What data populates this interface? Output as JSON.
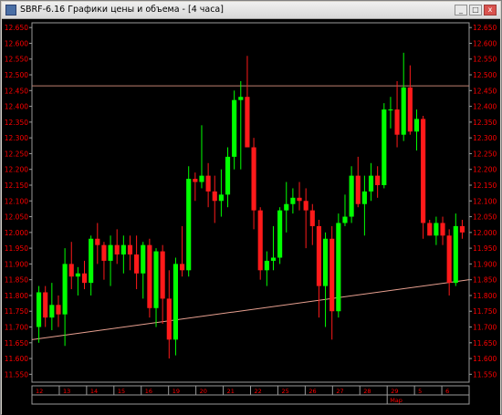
{
  "window": {
    "title": "SBRF-6.16 Графики цены и объема - [4 часа]",
    "buttons": {
      "minimize": "_",
      "maximize": "□",
      "close": "x"
    }
  },
  "chart_data": {
    "type": "candlestick",
    "title": "",
    "y_ticks": [
      "12.650",
      "12.600",
      "12.550",
      "12.500",
      "12.450",
      "12.400",
      "12.350",
      "12.300",
      "12.250",
      "12.200",
      "12.150",
      "12.100",
      "12.050",
      "12.000",
      "11.950",
      "11.900",
      "11.850",
      "11.800",
      "11.750",
      "11.700",
      "11.650",
      "11.600",
      "11.550"
    ],
    "ylim": [
      11.525,
      12.665
    ],
    "x_labels": [
      "12",
      "13",
      "14",
      "15",
      "16",
      "19",
      "20",
      "21",
      "22",
      "25",
      "26",
      "27",
      "28",
      "29",
      "5",
      "6"
    ],
    "x_sublabel": "Мар",
    "colors": {
      "up": "#00ff00",
      "down": "#ff1a1a",
      "axis_text": "#ff0000",
      "background": "#000000",
      "hline": "#c08070",
      "trendline": "#e8a090"
    },
    "horizontal_line": 12.465,
    "trendline": [
      [
        0,
        11.66
      ],
      [
        62,
        11.85
      ]
    ],
    "candles": [
      {
        "o": 11.7,
        "h": 11.83,
        "l": 11.65,
        "c": 11.81
      },
      {
        "o": 11.81,
        "h": 11.83,
        "l": 11.7,
        "c": 11.73
      },
      {
        "o": 11.73,
        "h": 11.84,
        "l": 11.69,
        "c": 11.77
      },
      {
        "o": 11.77,
        "h": 11.8,
        "l": 11.7,
        "c": 11.74
      },
      {
        "o": 11.74,
        "h": 11.95,
        "l": 11.64,
        "c": 11.9
      },
      {
        "o": 11.9,
        "h": 11.97,
        "l": 11.82,
        "c": 11.86
      },
      {
        "o": 11.86,
        "h": 11.89,
        "l": 11.8,
        "c": 11.87
      },
      {
        "o": 11.87,
        "h": 11.91,
        "l": 11.82,
        "c": 11.84
      },
      {
        "o": 11.84,
        "h": 11.99,
        "l": 11.8,
        "c": 11.98
      },
      {
        "o": 11.98,
        "h": 12.03,
        "l": 11.9,
        "c": 11.96
      },
      {
        "o": 11.96,
        "h": 11.97,
        "l": 11.85,
        "c": 11.91
      },
      {
        "o": 11.91,
        "h": 11.99,
        "l": 11.83,
        "c": 11.96
      },
      {
        "o": 11.96,
        "h": 12.01,
        "l": 11.9,
        "c": 11.93
      },
      {
        "o": 11.93,
        "h": 11.99,
        "l": 11.87,
        "c": 11.96
      },
      {
        "o": 11.96,
        "h": 11.99,
        "l": 11.88,
        "c": 11.93
      },
      {
        "o": 11.93,
        "h": 11.99,
        "l": 11.82,
        "c": 11.87
      },
      {
        "o": 11.87,
        "h": 11.97,
        "l": 11.79,
        "c": 11.96
      },
      {
        "o": 11.96,
        "h": 11.98,
        "l": 11.73,
        "c": 11.76
      },
      {
        "o": 11.76,
        "h": 11.95,
        "l": 11.7,
        "c": 11.94
      },
      {
        "o": 11.94,
        "h": 11.96,
        "l": 11.71,
        "c": 11.79
      },
      {
        "o": 11.79,
        "h": 11.88,
        "l": 11.6,
        "c": 11.66
      },
      {
        "o": 11.66,
        "h": 11.92,
        "l": 11.61,
        "c": 11.9
      },
      {
        "o": 11.9,
        "h": 12.02,
        "l": 11.86,
        "c": 11.88
      },
      {
        "o": 11.88,
        "h": 12.21,
        "l": 11.86,
        "c": 12.17
      },
      {
        "o": 12.17,
        "h": 12.19,
        "l": 12.1,
        "c": 12.16
      },
      {
        "o": 12.16,
        "h": 12.34,
        "l": 12.14,
        "c": 12.18
      },
      {
        "o": 12.18,
        "h": 12.22,
        "l": 12.08,
        "c": 12.13
      },
      {
        "o": 12.13,
        "h": 12.18,
        "l": 12.03,
        "c": 12.1
      },
      {
        "o": 12.1,
        "h": 12.2,
        "l": 12.05,
        "c": 12.12
      },
      {
        "o": 12.12,
        "h": 12.27,
        "l": 12.08,
        "c": 12.24
      },
      {
        "o": 12.24,
        "h": 12.45,
        "l": 12.2,
        "c": 12.42
      },
      {
        "o": 12.42,
        "h": 12.48,
        "l": 12.2,
        "c": 12.43
      },
      {
        "o": 12.43,
        "h": 12.56,
        "l": 12.3,
        "c": 12.27
      },
      {
        "o": 12.27,
        "h": 12.3,
        "l": 12.01,
        "c": 12.07
      },
      {
        "o": 12.07,
        "h": 12.08,
        "l": 11.85,
        "c": 11.88
      },
      {
        "o": 11.88,
        "h": 11.94,
        "l": 11.83,
        "c": 11.91
      },
      {
        "o": 11.91,
        "h": 12.02,
        "l": 11.88,
        "c": 11.92
      },
      {
        "o": 11.92,
        "h": 12.08,
        "l": 11.9,
        "c": 12.07
      },
      {
        "o": 12.07,
        "h": 12.16,
        "l": 12.0,
        "c": 12.09
      },
      {
        "o": 12.09,
        "h": 12.14,
        "l": 12.06,
        "c": 12.11
      },
      {
        "o": 12.11,
        "h": 12.16,
        "l": 12.07,
        "c": 12.1
      },
      {
        "o": 12.1,
        "h": 12.14,
        "l": 11.95,
        "c": 12.07
      },
      {
        "o": 12.07,
        "h": 12.09,
        "l": 11.96,
        "c": 12.02
      },
      {
        "o": 12.02,
        "h": 12.04,
        "l": 11.73,
        "c": 11.83
      },
      {
        "o": 11.83,
        "h": 12.0,
        "l": 11.7,
        "c": 11.98
      },
      {
        "o": 11.98,
        "h": 12.02,
        "l": 11.66,
        "c": 11.75
      },
      {
        "o": 11.75,
        "h": 12.06,
        "l": 11.73,
        "c": 12.03
      },
      {
        "o": 12.03,
        "h": 12.12,
        "l": 12.02,
        "c": 12.05
      },
      {
        "o": 12.05,
        "h": 12.21,
        "l": 12.03,
        "c": 12.18
      },
      {
        "o": 12.18,
        "h": 12.24,
        "l": 12.08,
        "c": 12.09
      },
      {
        "o": 12.09,
        "h": 12.18,
        "l": 11.99,
        "c": 12.13
      },
      {
        "o": 12.13,
        "h": 12.22,
        "l": 12.1,
        "c": 12.18
      },
      {
        "o": 12.18,
        "h": 12.21,
        "l": 12.11,
        "c": 12.15
      },
      {
        "o": 12.15,
        "h": 12.41,
        "l": 12.14,
        "c": 12.39
      },
      {
        "o": 12.39,
        "h": 12.43,
        "l": 12.33,
        "c": 12.39
      },
      {
        "o": 12.39,
        "h": 12.48,
        "l": 12.27,
        "c": 12.31
      },
      {
        "o": 12.31,
        "h": 12.57,
        "l": 12.29,
        "c": 12.46
      },
      {
        "o": 12.46,
        "h": 12.53,
        "l": 12.31,
        "c": 12.32
      },
      {
        "o": 12.32,
        "h": 12.39,
        "l": 12.26,
        "c": 12.36
      },
      {
        "o": 12.36,
        "h": 12.37,
        "l": 11.98,
        "c": 12.03
      },
      {
        "o": 12.03,
        "h": 12.04,
        "l": 11.99,
        "c": 11.99
      },
      {
        "o": 11.99,
        "h": 12.05,
        "l": 11.96,
        "c": 12.03
      },
      {
        "o": 12.03,
        "h": 12.05,
        "l": 11.96,
        "c": 11.99
      },
      {
        "o": 11.99,
        "h": 12.01,
        "l": 11.8,
        "c": 11.84
      },
      {
        "o": 11.84,
        "h": 12.06,
        "l": 11.83,
        "c": 12.02
      },
      {
        "o": 12.02,
        "h": 12.04,
        "l": 11.98,
        "c": 12.0
      }
    ]
  }
}
